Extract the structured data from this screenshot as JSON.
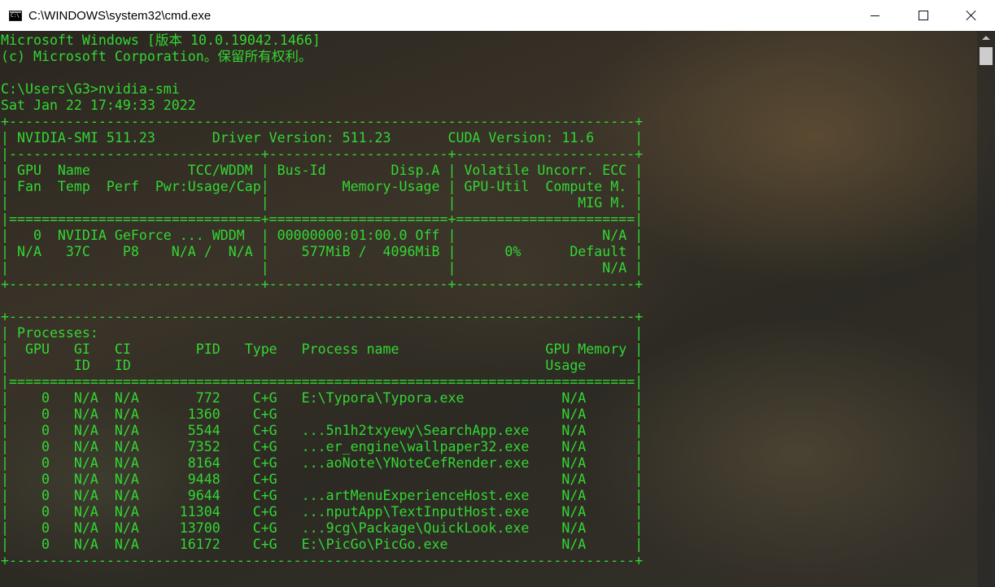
{
  "window": {
    "title": "C:\\WINDOWS\\system32\\cmd.exe",
    "icon": "cmd-icon",
    "controls": {
      "minimize": "minimize-icon",
      "maximize": "maximize-icon",
      "close": "close-icon"
    }
  },
  "colors": {
    "terminal_text": "#33d633",
    "titlebar_bg": "#ffffff"
  },
  "console": {
    "lines": [
      "Microsoft Windows [版本 10.0.19042.1466]",
      "(c) Microsoft Corporation。保留所有权利。",
      "",
      "C:\\Users\\G3>nvidia-smi",
      "Sat Jan 22 17:49:33 2022",
      "+-----------------------------------------------------------------------------+",
      "| NVIDIA-SMI 511.23       Driver Version: 511.23       CUDA Version: 11.6     |",
      "|-------------------------------+----------------------+----------------------+",
      "| GPU  Name            TCC/WDDM | Bus-Id        Disp.A | Volatile Uncorr. ECC |",
      "| Fan  Temp  Perf  Pwr:Usage/Cap|         Memory-Usage | GPU-Util  Compute M. |",
      "|                               |                      |               MIG M. |",
      "|===============================+======================+======================|",
      "|   0  NVIDIA GeForce ... WDDM  | 00000000:01:00.0 Off |                  N/A |",
      "| N/A   37C    P8    N/A /  N/A |    577MiB /  4096MiB |      0%      Default |",
      "|                               |                      |                  N/A |",
      "+-------------------------------+----------------------+----------------------+",
      "",
      "+-----------------------------------------------------------------------------+",
      "| Processes:                                                                  |",
      "|  GPU   GI   CI        PID   Type   Process name                  GPU Memory |",
      "|        ID   ID                                                   Usage      |",
      "|=============================================================================|",
      "|    0   N/A  N/A       772    C+G   E:\\Typora\\Typora.exe            N/A      |",
      "|    0   N/A  N/A      1360    C+G                                   N/A      |",
      "|    0   N/A  N/A      5544    C+G   ...5n1h2txyewy\\SearchApp.exe    N/A      |",
      "|    0   N/A  N/A      7352    C+G   ...er_engine\\wallpaper32.exe    N/A      |",
      "|    0   N/A  N/A      8164    C+G   ...aoNote\\YNoteCefRender.exe    N/A      |",
      "|    0   N/A  N/A      9448    C+G                                   N/A      |",
      "|    0   N/A  N/A      9644    C+G   ...artMenuExperienceHost.exe    N/A      |",
      "|    0   N/A  N/A     11304    C+G   ...nputApp\\TextInputHost.exe    N/A      |",
      "|    0   N/A  N/A     13700    C+G   ...9cg\\Package\\QuickLook.exe    N/A      |",
      "|    0   N/A  N/A     16172    C+G   E:\\PicGo\\PicGo.exe              N/A      |",
      "+-----------------------------------------------------------------------------+"
    ]
  }
}
